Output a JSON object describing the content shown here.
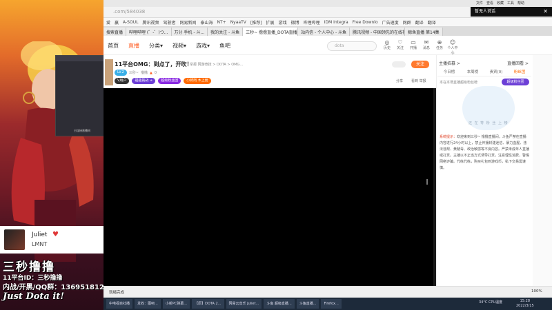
{
  "browser": {
    "url": ".com/584038",
    "menu": [
      "文件",
      "查看",
      "收藏",
      "工具",
      "帮助"
    ],
    "bookmarks": [
      "爱",
      "赢",
      "A-SOUL",
      "腾讯视频",
      "驾驶者",
      "网易新闻",
      "泰山海",
      "NT+",
      "NyaaTV",
      "[推荐]",
      "扩展",
      "游戏",
      "微博",
      "哔哩哔哩",
      "IDM Integra",
      "Free Downlo",
      "广告速度",
      "网群",
      "翻译",
      "翻译"
    ],
    "tabs": [
      {
        "label": "搜索直播",
        "active": false
      },
      {
        "label": "哔哩哔哩 (゜-゜)つ...",
        "active": false
      },
      {
        "label": "万分 手机 - 斗...",
        "active": false
      },
      {
        "label": "我的关注 - 斗鱼",
        "active": false
      },
      {
        "label": "三秒~ 撸撸直播_DOTA直播_斗...",
        "active": true
      },
      {
        "label": "站内信 - 个人中心 - 斗鱼",
        "active": false
      },
      {
        "label": "腾讯视频 - 中国领先的在线视频",
        "active": false
      },
      {
        "label": "鲸鱼直播 第14集",
        "active": false
      }
    ],
    "download_bar": "暂无人说话",
    "close_glyph": "✕"
  },
  "site_nav": {
    "items": [
      {
        "label": "首页",
        "active": false
      },
      {
        "label": "直播",
        "active": true
      },
      {
        "label": "分类▾",
        "active": false
      },
      {
        "label": "视频▾",
        "active": false
      },
      {
        "label": "游戏▾",
        "active": false
      },
      {
        "label": "鱼吧",
        "active": false
      }
    ],
    "search_placeholder": "dota",
    "icons": [
      {
        "glyph": "◎",
        "label": "历史",
        "name": "history-icon"
      },
      {
        "glyph": "♡",
        "label": "关注",
        "name": "follow-icon"
      },
      {
        "glyph": "▭",
        "label": "开播",
        "name": "broadcast-icon"
      },
      {
        "glyph": "✉",
        "label": "消息",
        "name": "message-icon"
      },
      {
        "glyph": "⊕",
        "label": "任务",
        "name": "task-icon"
      },
      {
        "glyph": "☺",
        "label": "个人中心",
        "name": "user-center-icon"
      }
    ]
  },
  "room": {
    "title": "11平台OMG：到点了，开吹！",
    "category": "举报   网游竞技 > DOTA > OMG...",
    "level_badge": "LV.2",
    "streamer": "三秒~",
    "platform": "撸撸",
    "heat": "0",
    "tags": [
      {
        "label": "V用户",
        "color": "#333333"
      },
      {
        "label": "福能挑战  +",
        "color": "#6c3fd6"
      },
      {
        "label": "超级粉丝团",
        "color": "#8a2be2"
      },
      {
        "label": "小鲜肉 木上册",
        "color": "#ff6a00"
      }
    ],
    "follow_label": "关注",
    "share_label": "分享",
    "report_label": "看到 举报"
  },
  "right_panel": {
    "header_left": "主播招募 >",
    "header_right": "直播回看 >",
    "tabs": [
      {
        "label": "今日榜",
        "active": false
      },
      {
        "label": "本周榜",
        "active": false
      },
      {
        "label": "贵宾(0)",
        "active": false
      },
      {
        "label": "粉丝团",
        "active": true
      }
    ],
    "rank_text": "本在本场直播超级粉丝榜",
    "rank_button": "超级粉丝团",
    "cloud_text": "还 在 等 粉 丝 上 榜",
    "notice_prefix": "系统提示：",
    "notice": "欢迎来到三秒~ 撸撸直播间，斗鱼严禁在直播内容进行24小时以上，禁止传播封建迷信、暴力血腥、违法违规、黄赌毒、政治敏感等不良内容。严禁未成年人直播或打赏。主播以不正当方式诱导打赏，注意理性消费，警惕网络诈骗。代练代练，购买礼包到游戏币，私下交易需谨慎。"
  },
  "status": {
    "left": "就绪完成",
    "zoom": "100%"
  },
  "taskbar": {
    "items": [
      "中电视自社播",
      "发收：图吧...",
      "小新PC弹幕...",
      "【原】DOTA 2...",
      "网易云音乐 Juliet...",
      "斗鱼 超级直播...",
      "斗鱼直播...",
      "Firefox..."
    ],
    "time": "15:28",
    "date": "2022/3/15",
    "weather": "34°C CPU温度"
  },
  "overlay": {
    "song": "Juliet",
    "artist": "LMNT",
    "heart_glyph": "♥",
    "popup_label": "已连接直播间",
    "caption1": "三秒撸撸",
    "caption2": "11平台ID：三秒撸撸",
    "caption3": "内战/开黑/QQ群：136951812",
    "caption4": "Just Dota it!"
  }
}
